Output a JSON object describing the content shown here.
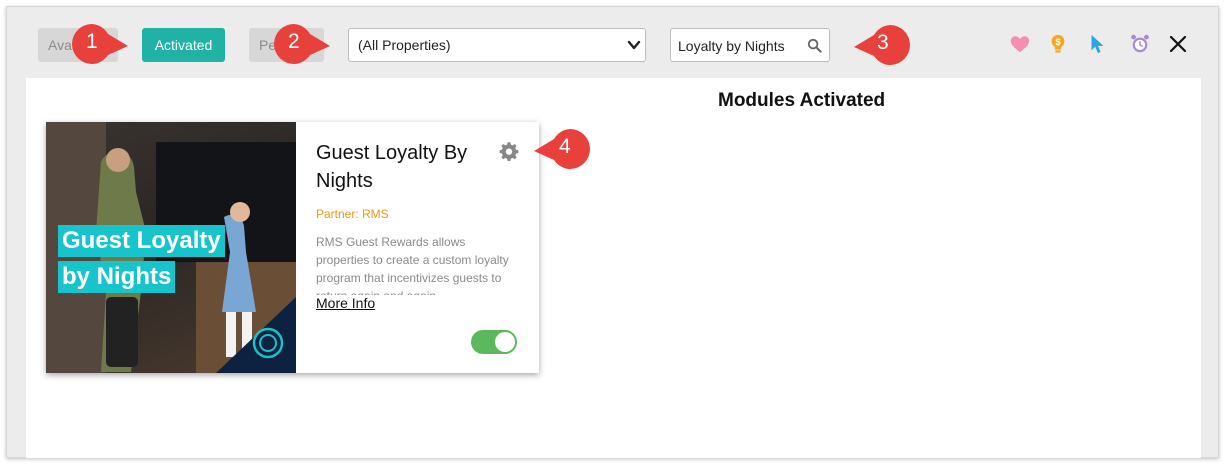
{
  "filters": {
    "available_label": "Available",
    "activated_label": "Activated",
    "pending_label": "Pending"
  },
  "property_select": {
    "value": "(All Properties)"
  },
  "search": {
    "value": "Loyalty by Nights"
  },
  "callouts": [
    "1",
    "2",
    "3",
    "4"
  ],
  "page_title": "Modules Activated",
  "card": {
    "image_text_line1": "Guest Loyalty",
    "image_text_line2": "by Nights",
    "title": "Guest Loyalty By Nights",
    "partner": "Partner: RMS",
    "description": "RMS Guest Rewards allows properties to create a custom loyalty program that incentivizes guests to return again and again....",
    "more_info": "More Info",
    "toggle_on": true
  },
  "icons": [
    "heart-icon",
    "lightbulb-icon",
    "pointer-icon",
    "alarm-clock-icon",
    "close-icon",
    "search-icon",
    "gear-icon",
    "chevron-down-icon"
  ],
  "colors": {
    "accent_teal": "#20b2a4",
    "callout_red": "#e8413b",
    "partner_orange": "#e69a1c",
    "toggle_green": "#5cb85c",
    "heart_pink": "#f48fb1",
    "bulb_orange": "#f5a623",
    "pointer_blue": "#29a8e0",
    "alarm_purple": "#a58bd6"
  }
}
